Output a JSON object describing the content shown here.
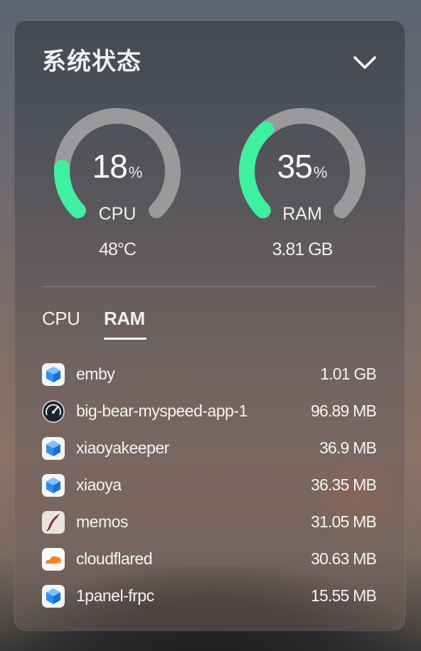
{
  "widget": {
    "title": "系统状态",
    "collapse_icon": "chevron-down-icon"
  },
  "gauges": {
    "cpu": {
      "value": "18",
      "unit": "%",
      "label": "CPU",
      "sub": "48°C",
      "percent": 18,
      "color": "#3ef0a0"
    },
    "ram": {
      "value": "35",
      "unit": "%",
      "label": "RAM",
      "sub": "3.81 GB",
      "percent": 35,
      "color": "#3ef0a0"
    }
  },
  "tabs": [
    {
      "label": "CPU",
      "active": false
    },
    {
      "label": "RAM",
      "active": true
    }
  ],
  "processes": [
    {
      "name": "emby",
      "memory": "1.01 GB",
      "icon": "cube-icon"
    },
    {
      "name": "big-bear-myspeed-app-1",
      "memory": "96.89 MB",
      "icon": "speedometer-icon"
    },
    {
      "name": "xiaoyakeeper",
      "memory": "36.9 MB",
      "icon": "cube-icon"
    },
    {
      "name": "xiaoya",
      "memory": "36.35 MB",
      "icon": "cube-icon"
    },
    {
      "name": "memos",
      "memory": "31.05 MB",
      "icon": "quill-icon"
    },
    {
      "name": "cloudflared",
      "memory": "30.63 MB",
      "icon": "cloud-icon"
    },
    {
      "name": "1panel-frpc",
      "memory": "15.55 MB",
      "icon": "cube-icon"
    }
  ]
}
